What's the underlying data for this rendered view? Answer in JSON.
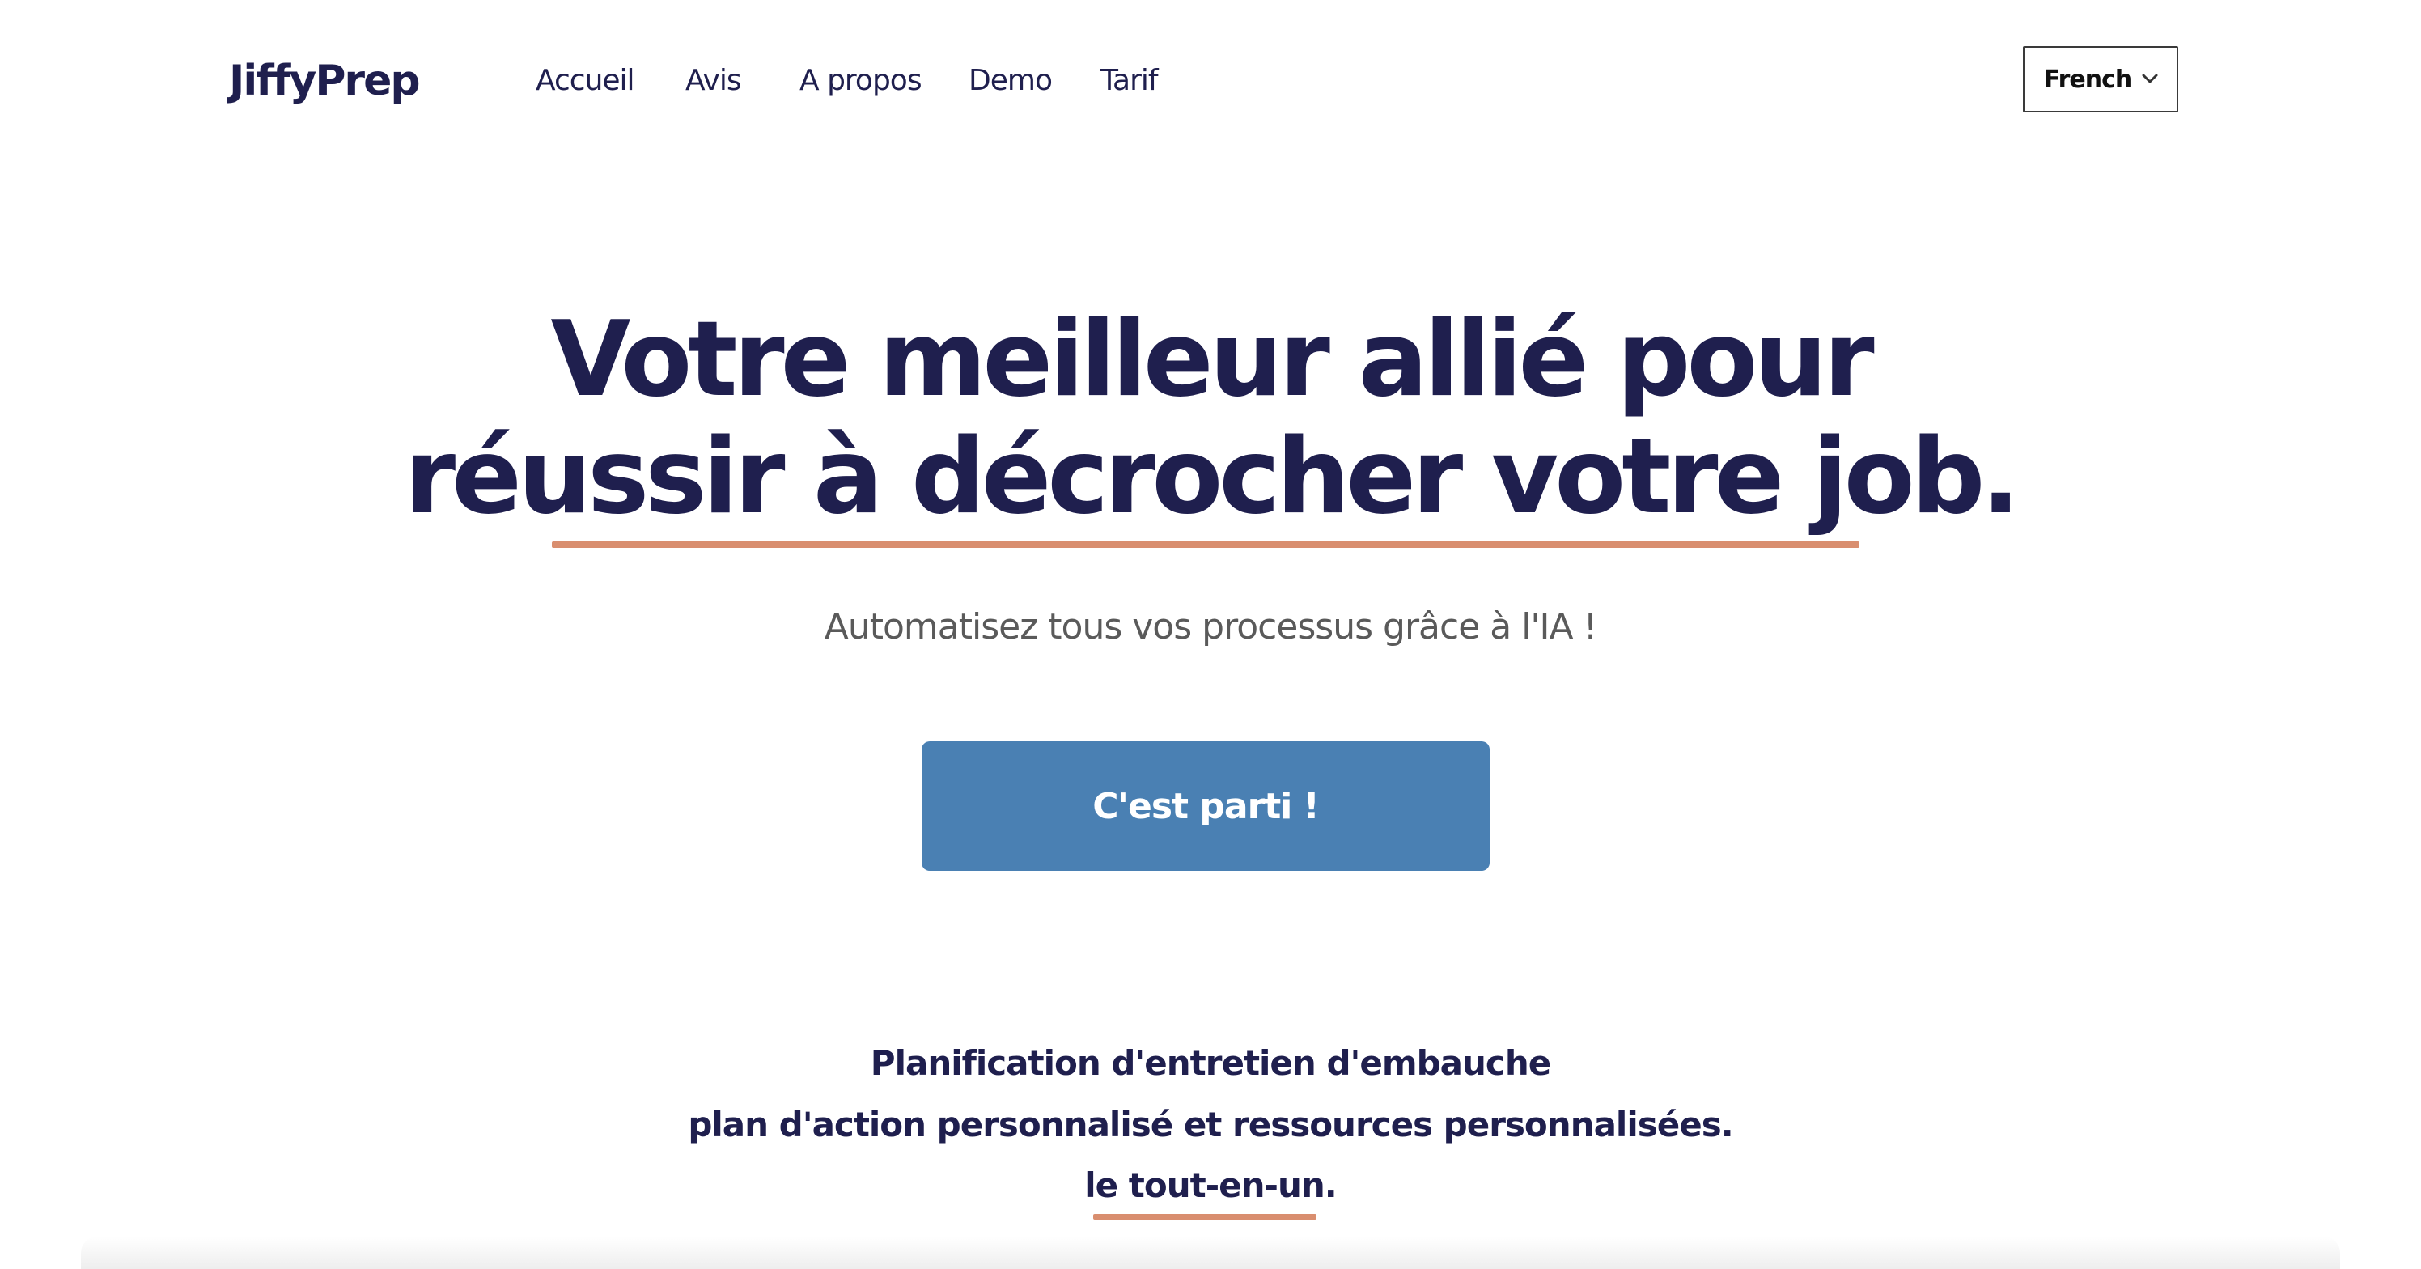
{
  "header": {
    "logo": "JiffyPrep",
    "nav": [
      {
        "label": "Accueil"
      },
      {
        "label": "Avis"
      },
      {
        "label": "A propos"
      },
      {
        "label": "Demo"
      },
      {
        "label": "Tarif"
      }
    ],
    "language": {
      "selected": "French",
      "icon": "chevron-down-icon"
    }
  },
  "hero": {
    "headline_line1": "Votre meilleur allié pour",
    "headline_line2": "réussir à décrocher votre job.",
    "subtitle": "Automatisez tous vos processus grâce à l'IA !",
    "cta_label": "C'est parti !"
  },
  "features": {
    "line1": "Planification d'entretien d'embauche",
    "line2": "plan d'action personnalisé et ressources personnalisées.",
    "line3": "le tout-en-un."
  },
  "colors": {
    "primary_text": "#1f1f4e",
    "accent_underline": "#d98e6f",
    "cta_background": "#4a80b3",
    "subtitle_text": "#5a5a5a"
  }
}
